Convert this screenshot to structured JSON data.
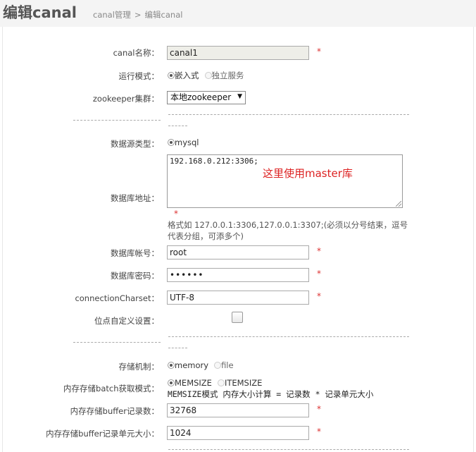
{
  "header": {
    "title": "编辑canal",
    "breadcrumb_home": "canal管理",
    "breadcrumb_sep": ">",
    "breadcrumb_current": "编辑canal"
  },
  "form": {
    "name": {
      "label": "canal名称：",
      "value": "canal1",
      "required": "*"
    },
    "run_mode": {
      "label": "运行模式：",
      "options": [
        "嵌入式",
        "独立服务"
      ],
      "selected": "嵌入式"
    },
    "zookeeper": {
      "label": "zookeeper集群：",
      "value": "本地zookeeper"
    },
    "divider_text": "----------------------------",
    "datasource_type": {
      "label": "数据源类型：",
      "option": "mysql",
      "selected": "mysql"
    },
    "db_address": {
      "label": "数据库地址：",
      "value": "192.168.0.212:3306;",
      "annotation": "这里使用master库",
      "required": "*",
      "hint": "格式如 127.0.0.1:3306,127.0.0.1:3307;(必须以分号结束，逗号代表分组，可添多个)"
    },
    "db_user": {
      "label": "数据库帐号：",
      "value": "root",
      "required": "*"
    },
    "db_password": {
      "label": "数据库密码：",
      "value": "••••••",
      "required": "*"
    },
    "charset": {
      "label": "connectionCharset：",
      "value": "UTF-8",
      "required": "*"
    },
    "position_custom": {
      "label": "位点自定义设置：",
      "checked": false
    },
    "storage_mode": {
      "label": "存储机制：",
      "options": [
        "memory",
        "file"
      ],
      "selected": "memory"
    },
    "batch_mode": {
      "label": "内存存储batch获取模式：",
      "options": [
        "MEMSIZE",
        "ITEMSIZE"
      ],
      "selected": "MEMSIZE",
      "note": "MEMSIZE模式 内存大小计算 = 记录数 * 记录单元大小"
    },
    "buffer_size": {
      "label": "内存存储buffer记录数：",
      "value": "32768",
      "required": "*"
    },
    "buffer_unit": {
      "label": "内存存储buffer记录单元大小：",
      "value": "1024",
      "required": "*"
    }
  }
}
